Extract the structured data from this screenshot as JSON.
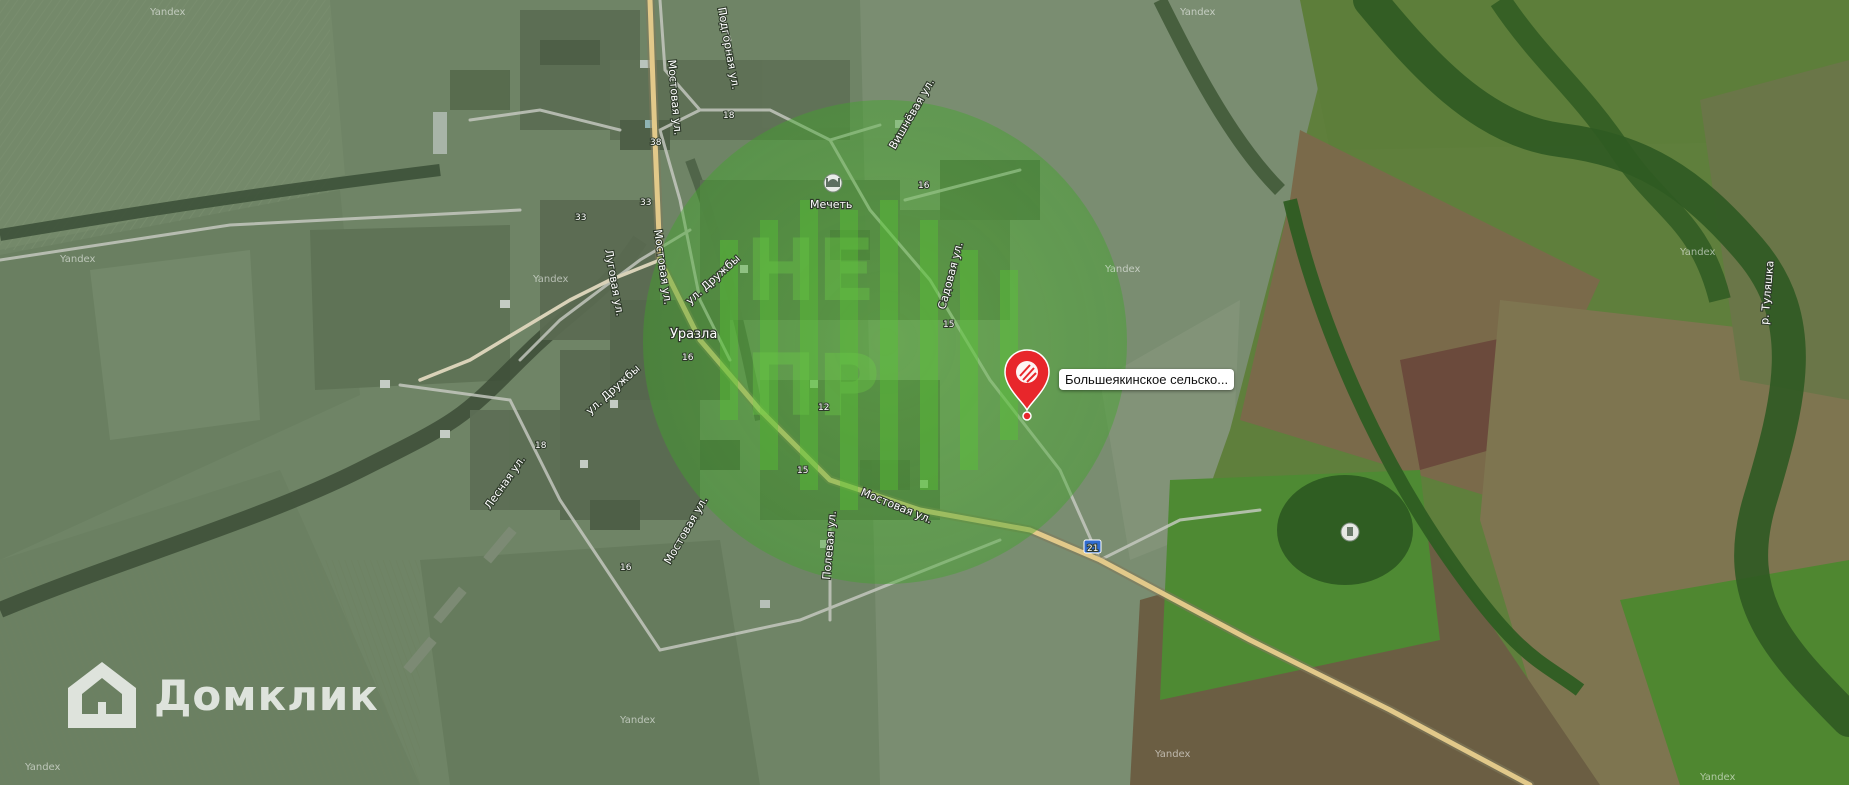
{
  "map": {
    "place_label": "Уразла",
    "poi": {
      "label": "Мечеть",
      "icon": "mosque-icon"
    },
    "marker": {
      "label": "Большеякинское сельско...",
      "icon": "map-pin-icon",
      "color": "#e8262b"
    },
    "streets": [
      "Мостовая ул.",
      "Мостовая ул.",
      "Мостовая ул.",
      "ул. Дружбы",
      "ул. Дружбы",
      "Мостовая ул.",
      "Вишнёвая ул.",
      "Садовая ул.",
      "Полевая ул.",
      "Луговая ул.",
      "Лесная ул.",
      "Подгорная ул."
    ],
    "house_numbers": [
      "38",
      "18",
      "33",
      "16",
      "18",
      "16",
      "15",
      "12",
      "15",
      "21",
      "33",
      "16"
    ],
    "road_shield": "21",
    "river_label": "р. Туляшка",
    "watermarks": [
      "Yandex",
      "Yandex",
      "Yandex",
      "Yandex",
      "Yandex",
      "Yandex",
      "Yandex",
      "Yandex",
      "Yandex",
      "Yandex"
    ],
    "brand": {
      "name": "Домклик",
      "icon": "house-logo-icon"
    },
    "overlay_stamp": {
      "text": "НЕ ПРОВЕРЕНО",
      "color": "#4caf2a"
    }
  }
}
